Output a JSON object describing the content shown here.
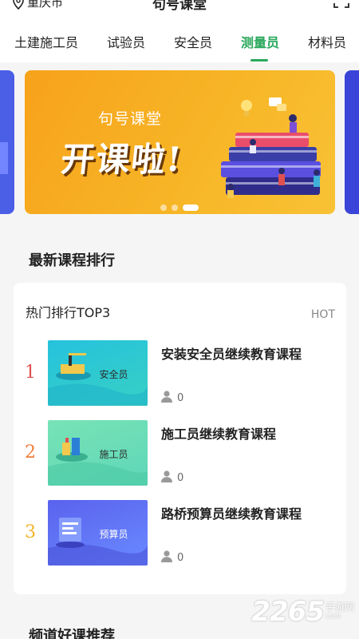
{
  "header": {
    "location": "重庆市",
    "app_title": "句号课堂"
  },
  "tabs": [
    {
      "label": "土建施工员"
    },
    {
      "label": "试验员"
    },
    {
      "label": "安全员"
    },
    {
      "label": "测量员",
      "active": true
    },
    {
      "label": "材料员"
    }
  ],
  "banner": {
    "subtitle": "句号课堂",
    "headline": "开课啦!",
    "slide_count": 3,
    "active_slide": 3
  },
  "latest_section": {
    "title": "最新课程排行",
    "card_title": "热门排行TOP3",
    "hot_label": "HOT",
    "courses": [
      {
        "rank": "1",
        "thumb_label": "安全员",
        "title": "安装安全员继续教育课程",
        "learners": "0",
        "rank_color": "#e05050",
        "thumb_color": "#2cc6d6"
      },
      {
        "rank": "2",
        "thumb_label": "施工员",
        "title": "施工员继续教育课程",
        "learners": "0",
        "rank_color": "#ef7d3a",
        "thumb_color": "#6fe0b0"
      },
      {
        "rank": "3",
        "thumb_label": "预算员",
        "title": "路桥预算员继续教育课程",
        "learners": "0",
        "rank_color": "#f2b32a",
        "thumb_color": "#5b6cf0"
      }
    ]
  },
  "channel_section": {
    "title": "频道好课推荐"
  },
  "watermark": {
    "number": "2265",
    "suffix": "手游网",
    "domain": "com"
  },
  "colors": {
    "accent": "#2aa85c",
    "banner": "#f7a21b"
  },
  "icons": [
    "location-pin-icon",
    "scan-icon",
    "person-icon"
  ]
}
